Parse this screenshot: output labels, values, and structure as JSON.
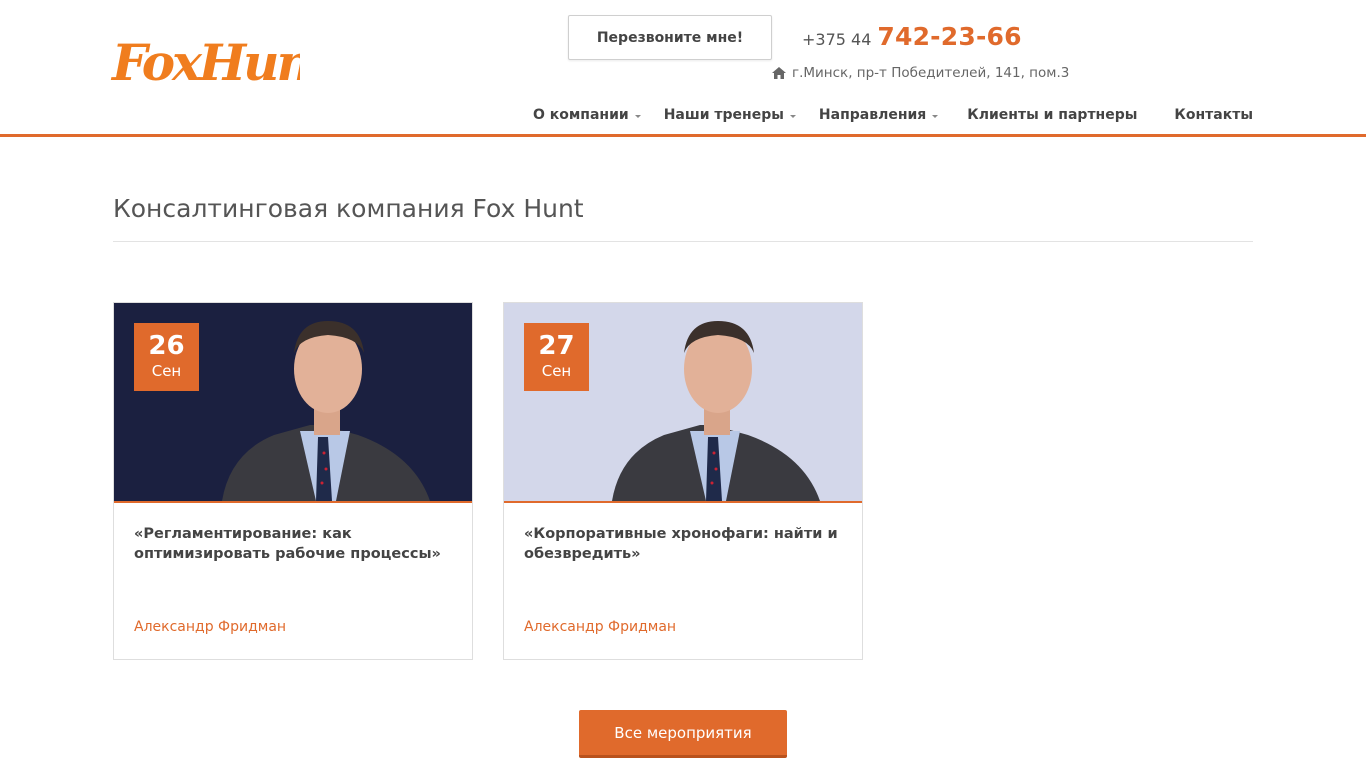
{
  "header": {
    "logo_text": "FoxHunt",
    "callback_label": "Перезвоните мне!",
    "phone_prefix": "+375 44",
    "phone_number": "742-23-66",
    "address": "г.Минск, пр-т Победителей, 141, пом.3",
    "accent_color": "#e06a2c"
  },
  "nav": {
    "items": [
      {
        "label": "О компании",
        "dropdown": true
      },
      {
        "label": "Наши тренеры",
        "dropdown": true
      },
      {
        "label": "Направления",
        "dropdown": true
      },
      {
        "label": "Клиенты и партнеры",
        "dropdown": false
      },
      {
        "label": "Контакты",
        "dropdown": false
      }
    ]
  },
  "main": {
    "title": "Консалтинговая компания Fox Hunt",
    "events": [
      {
        "day": "26",
        "month": "Сен",
        "title": "«Регламентирование: как оптимизировать рабочие процессы»",
        "author": "Александр Фридман",
        "image_bg": "#1b2040"
      },
      {
        "day": "27",
        "month": "Сен",
        "title": "«Корпоративные хронофаги: найти и обезвредить»",
        "author": "Александр Фридман",
        "image_bg": "#d3d7ea"
      }
    ],
    "all_events_label": "Все мероприятия"
  }
}
